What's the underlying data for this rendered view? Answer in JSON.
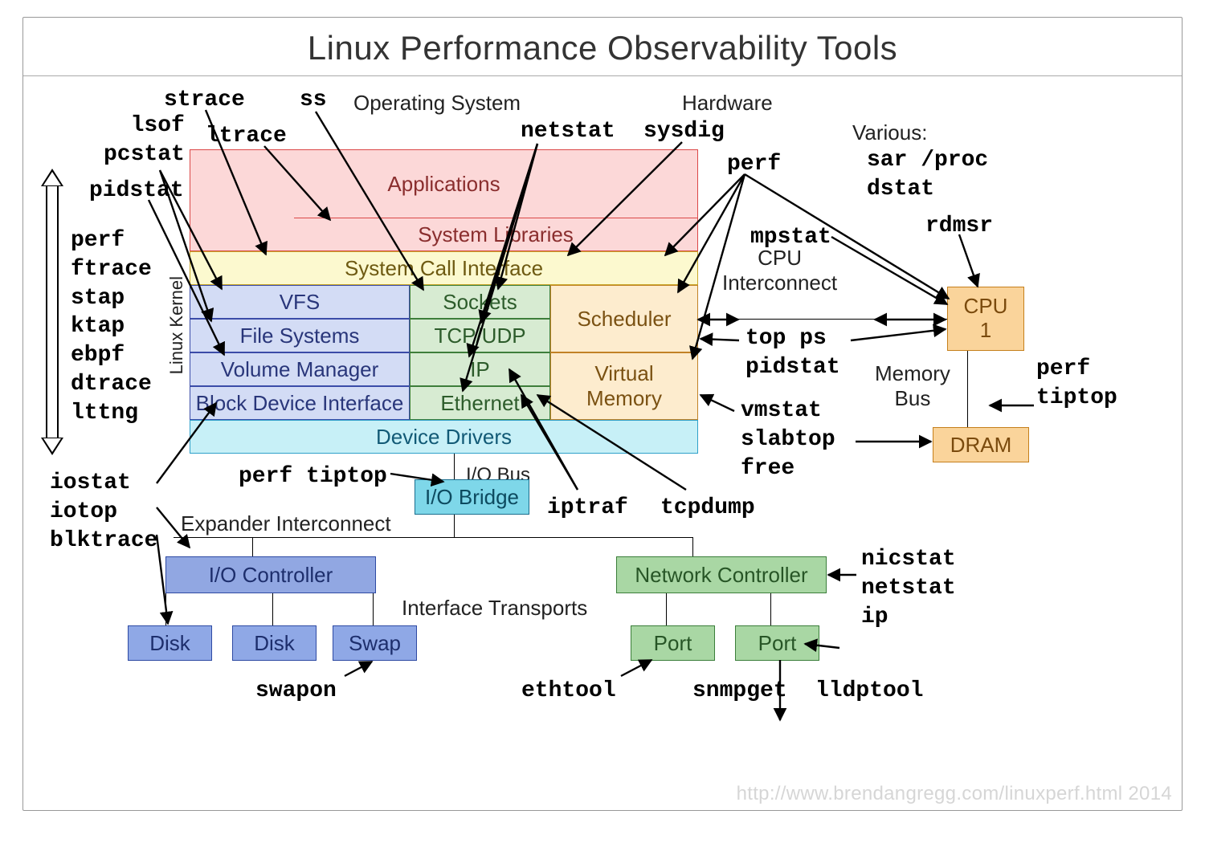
{
  "title": "Linux Performance Observability Tools",
  "sections": {
    "os": "Operating System",
    "hw": "Hardware",
    "kernel": "Linux Kernel"
  },
  "stack": {
    "applications": "Applications",
    "syslibs": "System Libraries",
    "sci": "System Call Interface",
    "vfs": "VFS",
    "fs": "File Systems",
    "volmgr": "Volume Manager",
    "bdi": "Block Device Interface",
    "sockets": "Sockets",
    "tcpudp": "TCP/UDP",
    "ip": "IP",
    "eth": "Ethernet",
    "sched": "Scheduler",
    "vmem": "Virtual\nMemory",
    "dd": "Device Drivers"
  },
  "hw": {
    "iobus": "I/O Bus",
    "iobridge": "I/O Bridge",
    "expander": "Expander Interconnect",
    "ioctl": "I/O Controller",
    "netctl": "Network Controller",
    "iftrans": "Interface Transports",
    "disk": "Disk",
    "swap": "Swap",
    "port": "Port",
    "cpu_ic": "CPU\nInterconnect",
    "cpu": "CPU\n1",
    "membus": "Memory\nBus",
    "dram": "DRAM"
  },
  "tools": {
    "strace": "strace",
    "ss": "ss",
    "lsof_pcstat": "lsof\npcstat",
    "ltrace": "ltrace",
    "netstat": "netstat",
    "sysdig": "sysdig",
    "pidstat": "pidstat",
    "perf": "perf",
    "left_stack": "perf\nftrace\nstap\nktap\nebpf\ndtrace\nlttng",
    "mpstat": "mpstat",
    "various_hdr": "Various:",
    "various": "sar /proc\ndstat",
    "rdmsr": "rdmsr",
    "top_ps_pidstat": "top ps\npidstat",
    "perf_tiptop_r": "perf\ntiptop",
    "vmstat_etc": "vmstat\nslabtop\nfree",
    "iostat_etc": "iostat\niotop\nblktrace",
    "perf_tiptop_l": "perf tiptop",
    "iptraf": "iptraf",
    "tcpdump": "tcpdump",
    "swapon": "swapon",
    "ethtool": "ethtool",
    "snmpget": "snmpget",
    "lldptool": "lldptool",
    "nicstat_etc": "nicstat\nnetstat\nip"
  },
  "footer": "http://www.brendangregg.com/linuxperf.html 2014"
}
